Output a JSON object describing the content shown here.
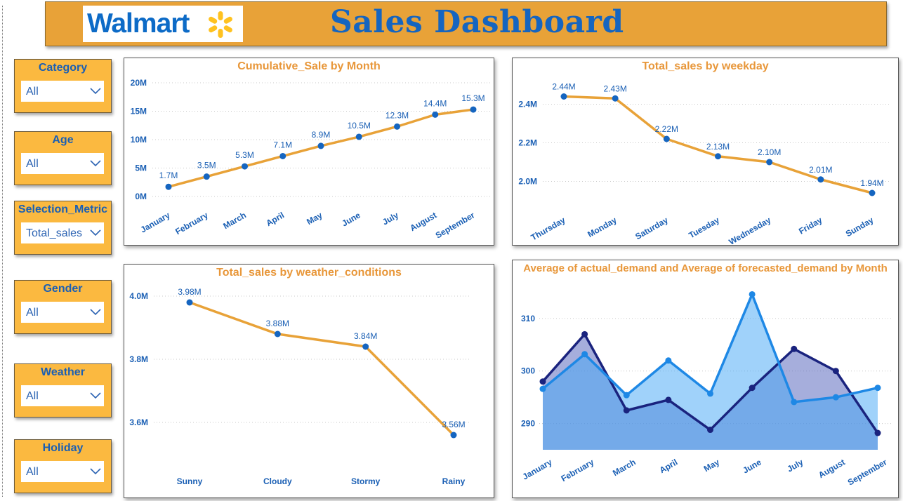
{
  "header": {
    "logo_text": "Walmart",
    "title": "Sales Dashboard"
  },
  "slicers": [
    {
      "label": "Category",
      "value": "All"
    },
    {
      "label": "Age",
      "value": "All"
    },
    {
      "label": "Selection_Metric",
      "value": "Total_sales"
    },
    {
      "label": "Gender",
      "value": "All"
    },
    {
      "label": "Weather",
      "value": "All"
    },
    {
      "label": "Holiday",
      "value": "All"
    }
  ],
  "colors": {
    "header": "#e8a238",
    "slicer": "#fbb940",
    "line": "#e8a238",
    "marker": "#1565c0",
    "label": "#1a5fb4",
    "title": "#e8973a",
    "actual": "#1a237e",
    "forecast": "#1e88e5"
  },
  "chart_data": [
    {
      "type": "line",
      "title": "Cumulative_Sale by Month",
      "categories": [
        "January",
        "February",
        "March",
        "April",
        "May",
        "June",
        "July",
        "August",
        "September"
      ],
      "values": [
        1.7,
        3.5,
        5.3,
        7.1,
        8.9,
        10.5,
        12.3,
        14.4,
        15.3
      ],
      "data_labels": [
        "1.7M",
        "3.5M",
        "5.3M",
        "7.1M",
        "8.9M",
        "10.5M",
        "12.3M",
        "14.4M",
        "15.3M"
      ],
      "ylim": [
        0,
        20
      ],
      "yticks": [
        "0M",
        "5M",
        "10M",
        "15M",
        "20M"
      ],
      "ytick_values": [
        0,
        5,
        10,
        15,
        20
      ],
      "unit": "M",
      "grid": true
    },
    {
      "type": "line",
      "title": "Total_sales by weekday",
      "categories": [
        "Thursday",
        "Monday",
        "Saturday",
        "Tuesday",
        "Wednesday",
        "Friday",
        "Sunday"
      ],
      "values": [
        2.44,
        2.43,
        2.22,
        2.13,
        2.1,
        2.01,
        1.94
      ],
      "data_labels": [
        "2.44M",
        "2.43M",
        "2.22M",
        "2.13M",
        "2.10M",
        "2.01M",
        "1.94M"
      ],
      "ylim": [
        1.9,
        2.5
      ],
      "yticks": [
        "2.0M",
        "2.2M",
        "2.4M"
      ],
      "ytick_values": [
        2.0,
        2.2,
        2.4
      ],
      "unit": "M",
      "grid": true
    },
    {
      "type": "line",
      "title": "Total_sales by weather_conditions",
      "categories": [
        "Sunny",
        "Cloudy",
        "Stormy",
        "Rainy"
      ],
      "values": [
        3.98,
        3.88,
        3.84,
        3.56
      ],
      "data_labels": [
        "3.98M",
        "3.88M",
        "3.84M",
        "3.56M"
      ],
      "ylim": [
        3.5,
        4.02
      ],
      "yticks": [
        "3.6M",
        "3.8M",
        "4.0M"
      ],
      "ytick_values": [
        3.6,
        3.8,
        4.0
      ],
      "unit": "M",
      "grid": true
    },
    {
      "type": "area",
      "title": "Average of actual_demand and Average of forecasted_demand by Month",
      "categories": [
        "January",
        "February",
        "March",
        "April",
        "May",
        "June",
        "July",
        "August",
        "September"
      ],
      "series": [
        {
          "values": [
            298.0,
            307.0,
            292.5,
            294.5,
            288.8,
            296.8,
            304.2,
            300.0,
            288.2
          ]
        },
        {
          "values": [
            296.6,
            303.2,
            295.4,
            302.0,
            295.7,
            314.6,
            294.1,
            295.0,
            296.8
          ]
        }
      ],
      "ylim": [
        285,
        316
      ],
      "yticks": [
        "290",
        "300",
        "310"
      ],
      "ytick_values": [
        290,
        300,
        310
      ],
      "grid": true
    }
  ]
}
